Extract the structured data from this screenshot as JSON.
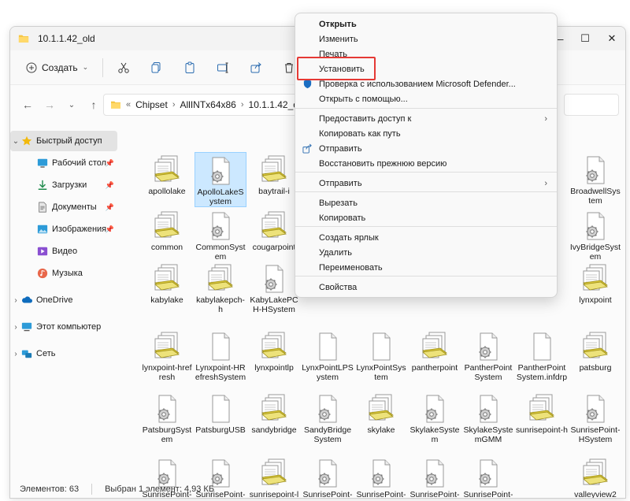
{
  "window": {
    "title": "10.1.1.42_old"
  },
  "window_controls": {
    "minimize": "—",
    "maximize": "☐",
    "close": "✕"
  },
  "toolbar": {
    "new_label": "Создать"
  },
  "address": {
    "prefix": "«",
    "crumbs": [
      "Chipset",
      "AllINTx64x86",
      "10.1.1.42_old"
    ],
    "separator": "›"
  },
  "sidebar": {
    "items": [
      {
        "label": "Быстрый доступ"
      },
      {
        "label": "Рабочий стол"
      },
      {
        "label": "Загрузки"
      },
      {
        "label": "Документы"
      },
      {
        "label": "Изображения"
      },
      {
        "label": "Видео"
      },
      {
        "label": "Музыка"
      },
      {
        "label": "OneDrive"
      },
      {
        "label": "Этот компьютер"
      },
      {
        "label": "Сеть"
      }
    ]
  },
  "files": [
    {
      "name": "apollolake",
      "type": "inf"
    },
    {
      "name": "ApolloLakeSystem",
      "type": "cat"
    },
    {
      "name": "baytrail-i",
      "type": "inf"
    },
    {
      "name": "BroadwellSystem",
      "type": "cat"
    },
    {
      "name": "common",
      "type": "inf"
    },
    {
      "name": "CommonSystem",
      "type": "cat"
    },
    {
      "name": "cougarpoint",
      "type": "inf"
    },
    {
      "name": "IvyBridgeSystem",
      "type": "cat"
    },
    {
      "name": "kabylake",
      "type": "inf"
    },
    {
      "name": "kabylakepch-h",
      "type": "inf"
    },
    {
      "name": "KabyLakePCH-HSystem",
      "type": "cat"
    },
    {
      "name": "lynxpoint",
      "type": "inf"
    },
    {
      "name": "lynxpoint-hrefresh",
      "type": "inf"
    },
    {
      "name": "Lynxpoint-HRefreshSystem",
      "type": "doc"
    },
    {
      "name": "lynxpointlp",
      "type": "inf"
    },
    {
      "name": "LynxPointLPSystem",
      "type": "doc"
    },
    {
      "name": "LynxPointSystem",
      "type": "doc"
    },
    {
      "name": "pantherpoint",
      "type": "inf"
    },
    {
      "name": "PantherPointSystem",
      "type": "cat"
    },
    {
      "name": "PantherPointSystem.infdrp",
      "type": "doc"
    },
    {
      "name": "patsburg",
      "type": "inf"
    },
    {
      "name": "PatsburgSystem",
      "type": "cat"
    },
    {
      "name": "PatsburgUSB",
      "type": "doc"
    },
    {
      "name": "sandybridge",
      "type": "inf"
    },
    {
      "name": "SandyBridgeSystem",
      "type": "cat"
    },
    {
      "name": "skylake",
      "type": "inf"
    },
    {
      "name": "SkylakeSystem",
      "type": "cat"
    },
    {
      "name": "SkylakeSystemGMM",
      "type": "cat"
    },
    {
      "name": "sunrisepoint-h",
      "type": "inf"
    },
    {
      "name": "SunrisePoint-HSystem",
      "type": "cat"
    },
    {
      "name": "SunrisePoint-HSyste",
      "type": "cat"
    },
    {
      "name": "SunrisePoint-HSyste",
      "type": "cat"
    },
    {
      "name": "sunrisepoint-lp",
      "type": "inf"
    },
    {
      "name": "SunrisePoint-LPSDHo",
      "type": "cat"
    },
    {
      "name": "SunrisePoint-LPSyste",
      "type": "cat"
    },
    {
      "name": "SunrisePoint-LPSyste",
      "type": "cat"
    },
    {
      "name": "SunrisePoint-LPSyste",
      "type": "cat"
    },
    {
      "name": "valleyview2",
      "type": "inf"
    }
  ],
  "status": {
    "count": "Элементов: 63",
    "selection": "Выбран 1 элемент: 4,93 КБ"
  },
  "context_menu": {
    "items": [
      {
        "label": "Открыть",
        "bold": true
      },
      {
        "label": "Изменить"
      },
      {
        "label": "Печать"
      },
      {
        "label": "Установить"
      },
      {
        "label": "Проверка с использованием Microsoft Defender..."
      },
      {
        "label": "Открыть с помощью..."
      },
      {
        "label": "Предоставить доступ к",
        "submenu": true
      },
      {
        "label": "Копировать как путь"
      },
      {
        "label": "Отправить"
      },
      {
        "label": "Восстановить прежнюю версию"
      },
      {
        "label": "Отправить",
        "submenu": true
      },
      {
        "label": "Вырезать"
      },
      {
        "label": "Копировать"
      },
      {
        "label": "Создать ярлык"
      },
      {
        "label": "Удалить"
      },
      {
        "label": "Переименовать"
      },
      {
        "label": "Свойства"
      }
    ]
  },
  "colors": {
    "selection_bg": "#cce8ff",
    "highlight_border": "#e53935",
    "accent": "#0067c0"
  }
}
